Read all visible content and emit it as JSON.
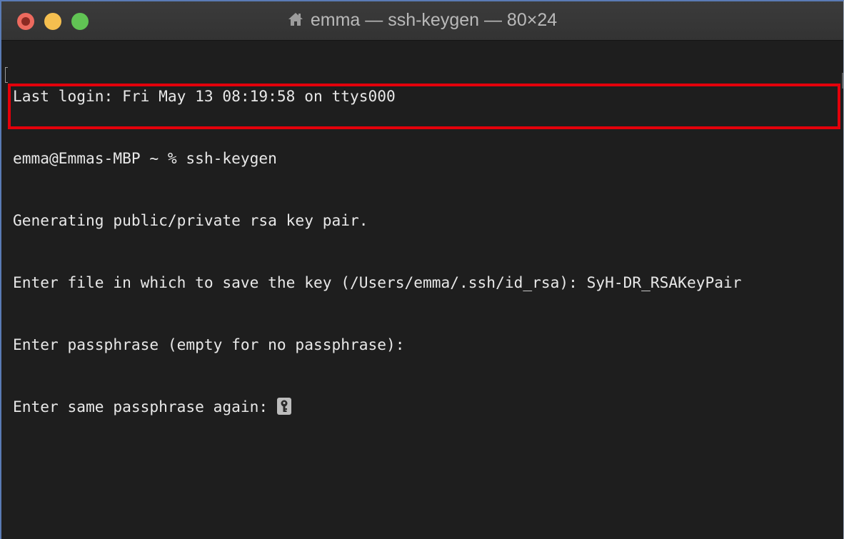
{
  "window": {
    "title": "emma — ssh-keygen — 80×24",
    "title_icon": "house-icon"
  },
  "colors": {
    "terminal_background": "#1e1e1e",
    "terminal_text": "#e8e8e8",
    "highlight": "#e3000b",
    "traffic_close": "#ed6a5e",
    "traffic_minimize": "#f5bf4f",
    "traffic_maximize": "#61c454"
  },
  "terminal": {
    "lines": [
      "Last login: Fri May 13 08:19:58 on ttys000",
      "emma@Emmas-MBP ~ % ssh-keygen",
      "Generating public/private rsa key pair.",
      "Enter file in which to save the key (/Users/emma/.ssh/id_rsa): SyH-DR_RSAKeyPair",
      "Enter passphrase (empty for no passphrase):",
      "Enter same passphrase again: "
    ],
    "cursor_icon": "key-icon",
    "highlighted_lines": [
      5,
      6
    ]
  }
}
